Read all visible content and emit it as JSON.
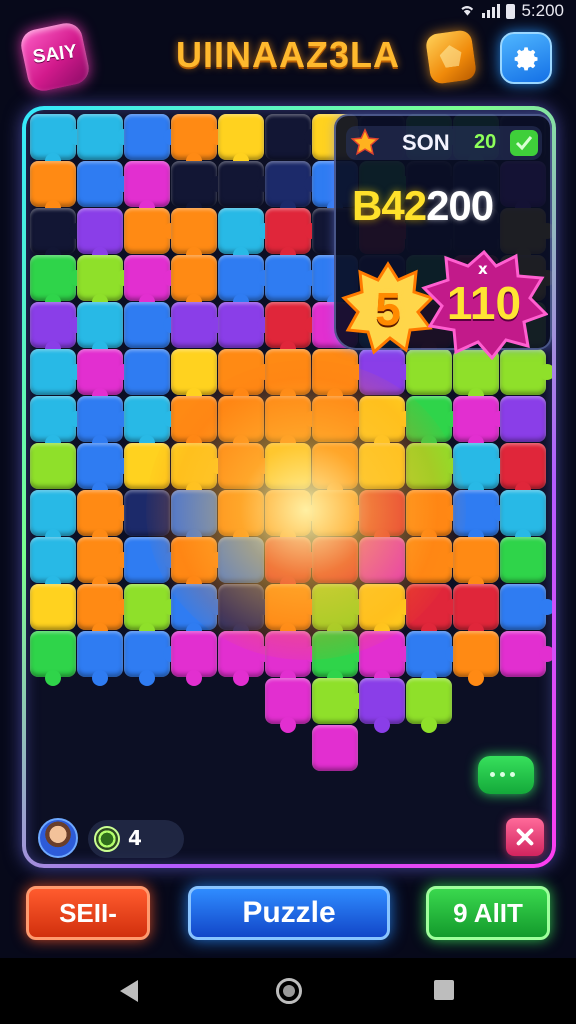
{
  "status_bar": {
    "time": "5:200"
  },
  "header": {
    "logo_text": "SAIY",
    "title": "UIINAAZ3LA",
    "gold_icon": "gold-gem-icon",
    "settings_icon": "gear-icon"
  },
  "scoreboard": {
    "player_name": "SON",
    "player_count": "20",
    "score_prefix": "B42",
    "score_rest": "200",
    "level_badge": "5",
    "multiplier_sign": "x",
    "multiplier_value": "110"
  },
  "bottom_strip": {
    "coin_count": "4"
  },
  "buttons": {
    "sell": "SEII-",
    "puzzle": "Puzzle",
    "alt": "9 AlIT"
  },
  "colors": {
    "orange": "#ff8a14",
    "yellow": "#ffd21f",
    "green": "#2fd44a",
    "lime": "#8fe02a",
    "blue": "#2f7cf2",
    "cyan": "#28b9e6",
    "purple": "#8a3ee8",
    "magenta": "#e22fd0",
    "red": "#e0263a",
    "navy": "#1c2a6a",
    "dark": "#121634"
  }
}
